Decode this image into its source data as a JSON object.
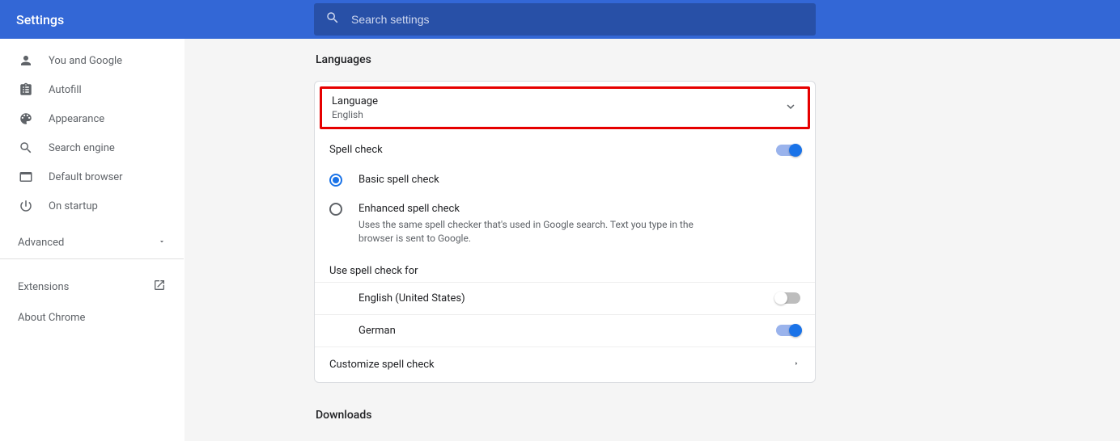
{
  "header": {
    "title": "Settings"
  },
  "search": {
    "placeholder": "Search settings"
  },
  "sidebar": {
    "items": [
      {
        "label": "You and Google"
      },
      {
        "label": "Autofill"
      },
      {
        "label": "Appearance"
      },
      {
        "label": "Search engine"
      },
      {
        "label": "Default browser"
      },
      {
        "label": "On startup"
      }
    ],
    "advanced_label": "Advanced",
    "extensions_label": "Extensions",
    "about_label": "About Chrome"
  },
  "main": {
    "languages_title": "Languages",
    "language_row": {
      "label": "Language",
      "value": "English"
    },
    "spell_check_label": "Spell check",
    "spell_check_enabled": true,
    "basic_label": "Basic spell check",
    "enhanced_label": "Enhanced spell check",
    "enhanced_desc": "Uses the same spell checker that's used in Google search. Text you type in the browser is sent to Google.",
    "use_for_label": "Use spell check for",
    "langs": [
      {
        "name": "English (United States)",
        "enabled": false
      },
      {
        "name": "German",
        "enabled": true
      }
    ],
    "customize_label": "Customize spell check",
    "downloads_title": "Downloads"
  }
}
